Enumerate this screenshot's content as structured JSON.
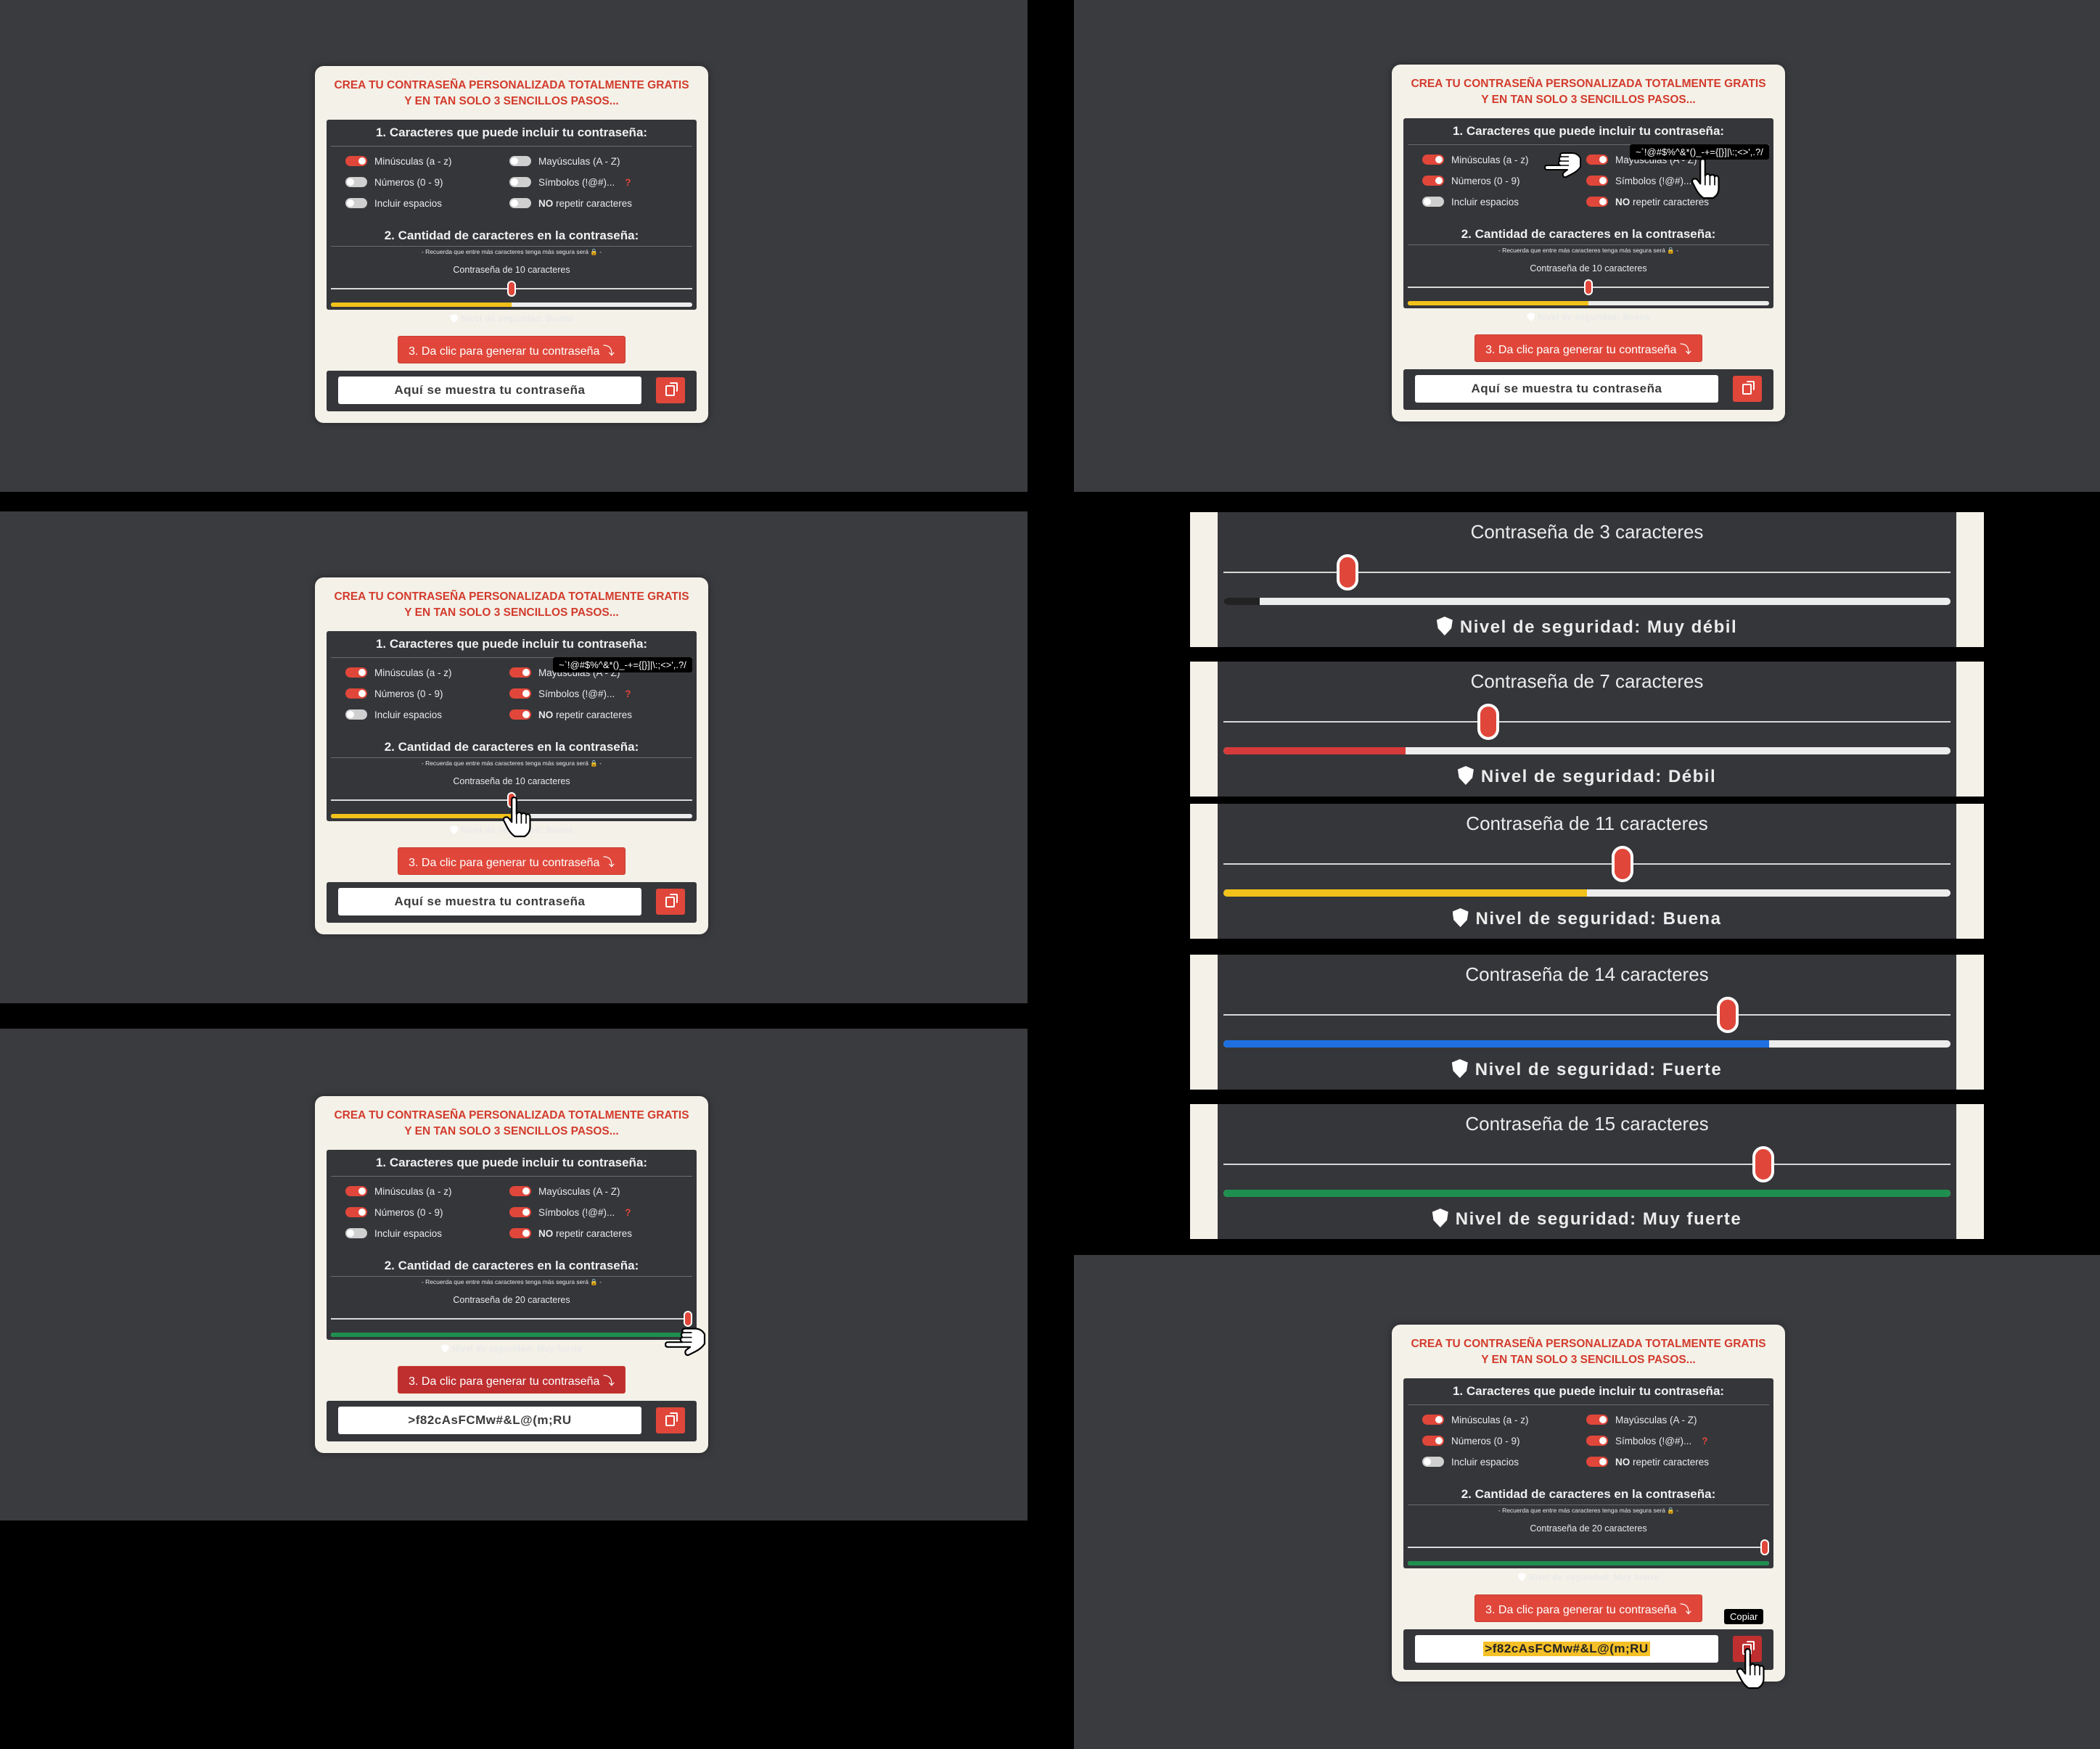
{
  "card": {
    "title": "CREA TU CONTRASEÑA PERSONALIZADA TOTALMENTE GRATIS Y EN TAN SOLO 3 SENCILLOS PASOS...",
    "section1": "1. Caracteres que puede incluir tu contraseña:",
    "options": {
      "lower": "Minúsculas (a - z)",
      "upper": "Mayúsculas (A - Z)",
      "numbers": "Números (0 - 9)",
      "symbols": "Símbolos (!@#)...",
      "symbols_help": "?",
      "spaces": "Incluir espacios",
      "norepeat_strong": "NO",
      "norepeat_rest": " repetir caracteres"
    },
    "section2": "2. Cantidad de caracteres en la contraseña:",
    "hint": "- Recuerda que entre más caracteres tenga más segura será 🔒 -",
    "generate_button": "3. Da clic para generar tu contraseña ⤵",
    "output_placeholder": "Aquí se muestra tu contraseña",
    "symbols_tooltip": "~`!@#$%^&*()_-+={[}]|\\:;<>',.?/",
    "copy_tooltip": "Copiar",
    "level_prefix": "Nivel de seguridad: ",
    "length_prefix": "Contraseña de ",
    "length_suffix": " caracteres"
  },
  "screens": [
    {
      "length_label": "Contraseña de 10 caracteres",
      "level_label": "Nivel de seguridad: Buena",
      "slider": 0.5,
      "meter": 0.5,
      "meter_color": "#f2c21b",
      "output": "Aquí se muestra tu contraseña",
      "toggles": {
        "lower": true,
        "upper": false,
        "numbers": false,
        "symbols": false,
        "spaces": false,
        "norepeat": false
      }
    },
    {
      "length_label": "Contraseña de 10 caracteres",
      "level_label": "Nivel de seguridad: Buena",
      "slider": 0.5,
      "meter": 0.5,
      "meter_color": "#f2c21b",
      "output": "Aquí se muestra tu contraseña",
      "toggles": {
        "lower": true,
        "upper": true,
        "numbers": true,
        "symbols": true,
        "spaces": false,
        "norepeat": true
      }
    },
    {
      "length_label": "Contraseña de 10 caracteres",
      "level_label": "Nivel de seguridad: Buena",
      "slider": 0.5,
      "meter": 0.5,
      "meter_color": "#f2c21b",
      "output": "Aquí se muestra tu contraseña",
      "toggles": {
        "lower": true,
        "upper": true,
        "numbers": true,
        "symbols": true,
        "spaces": false,
        "norepeat": true
      }
    },
    {
      "length_label": "Contraseña de 20 caracteres",
      "level_label": "Nivel de seguridad: Muy fuerte",
      "slider": 1.0,
      "meter": 1.0,
      "meter_color": "#1e8f4e",
      "output": ">f82cAsFCMw#&L@(m;RU",
      "toggles": {
        "lower": true,
        "upper": true,
        "numbers": true,
        "symbols": true,
        "spaces": false,
        "norepeat": true
      }
    },
    {
      "length_label": "Contraseña de 20 caracteres",
      "level_label": "Nivel de seguridad: Muy fuerte",
      "slider": 1.0,
      "meter": 1.0,
      "meter_color": "#1e8f4e",
      "output": ">f82cAsFCMw#&L@(m;RU",
      "toggles": {
        "lower": true,
        "upper": true,
        "numbers": true,
        "symbols": true,
        "spaces": false,
        "norepeat": true
      }
    }
  ],
  "zoom_strips": [
    {
      "length": "3",
      "level": "Muy débil",
      "slider": 0.16,
      "meter": 0.05,
      "meter_color": "#222222"
    },
    {
      "length": "7",
      "level": "Débil",
      "slider": 0.36,
      "meter": 0.25,
      "meter_color": "#d63a3a"
    },
    {
      "length": "11",
      "level": "Buena",
      "slider": 0.55,
      "meter": 0.5,
      "meter_color": "#f2c21b"
    },
    {
      "length": "14",
      "level": "Fuerte",
      "slider": 0.7,
      "meter": 0.75,
      "meter_color": "#1f6fe0"
    },
    {
      "length": "15",
      "level": "Muy fuerte",
      "slider": 0.75,
      "meter": 1.0,
      "meter_color": "#1e8f4e"
    }
  ],
  "colors": {
    "accent": "#e0473a",
    "panel": "#3a3b3f",
    "card": "#f3f1e8",
    "dark": "#35363a"
  }
}
